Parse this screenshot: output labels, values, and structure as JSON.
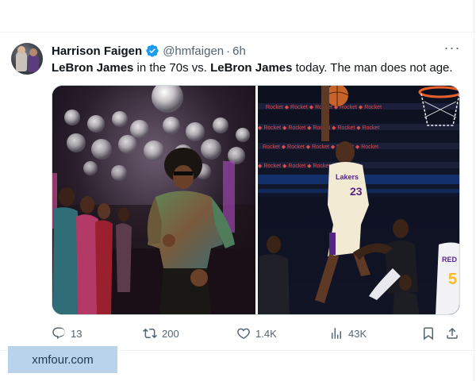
{
  "tweet": {
    "author_name": "Harrison Faigen",
    "handle": "@hmfaigen",
    "separator": "·",
    "time": "6h",
    "text_parts": {
      "bold1": "LeBron James",
      "plain1": " in the 70s vs. ",
      "bold2": "LeBron James",
      "plain2": " today. The man does not age."
    },
    "media": [
      {
        "icon": "disco-party-photo"
      },
      {
        "icon": "basketball-dunk-photo"
      }
    ]
  },
  "actions": {
    "replies": "13",
    "reposts": "200",
    "likes": "1.4K",
    "views": "43K"
  },
  "watermark": "xmfour.com",
  "colors": {
    "verified": "#1d9bf0",
    "secondary_text": "#536471",
    "primary_text": "#0f1419"
  }
}
